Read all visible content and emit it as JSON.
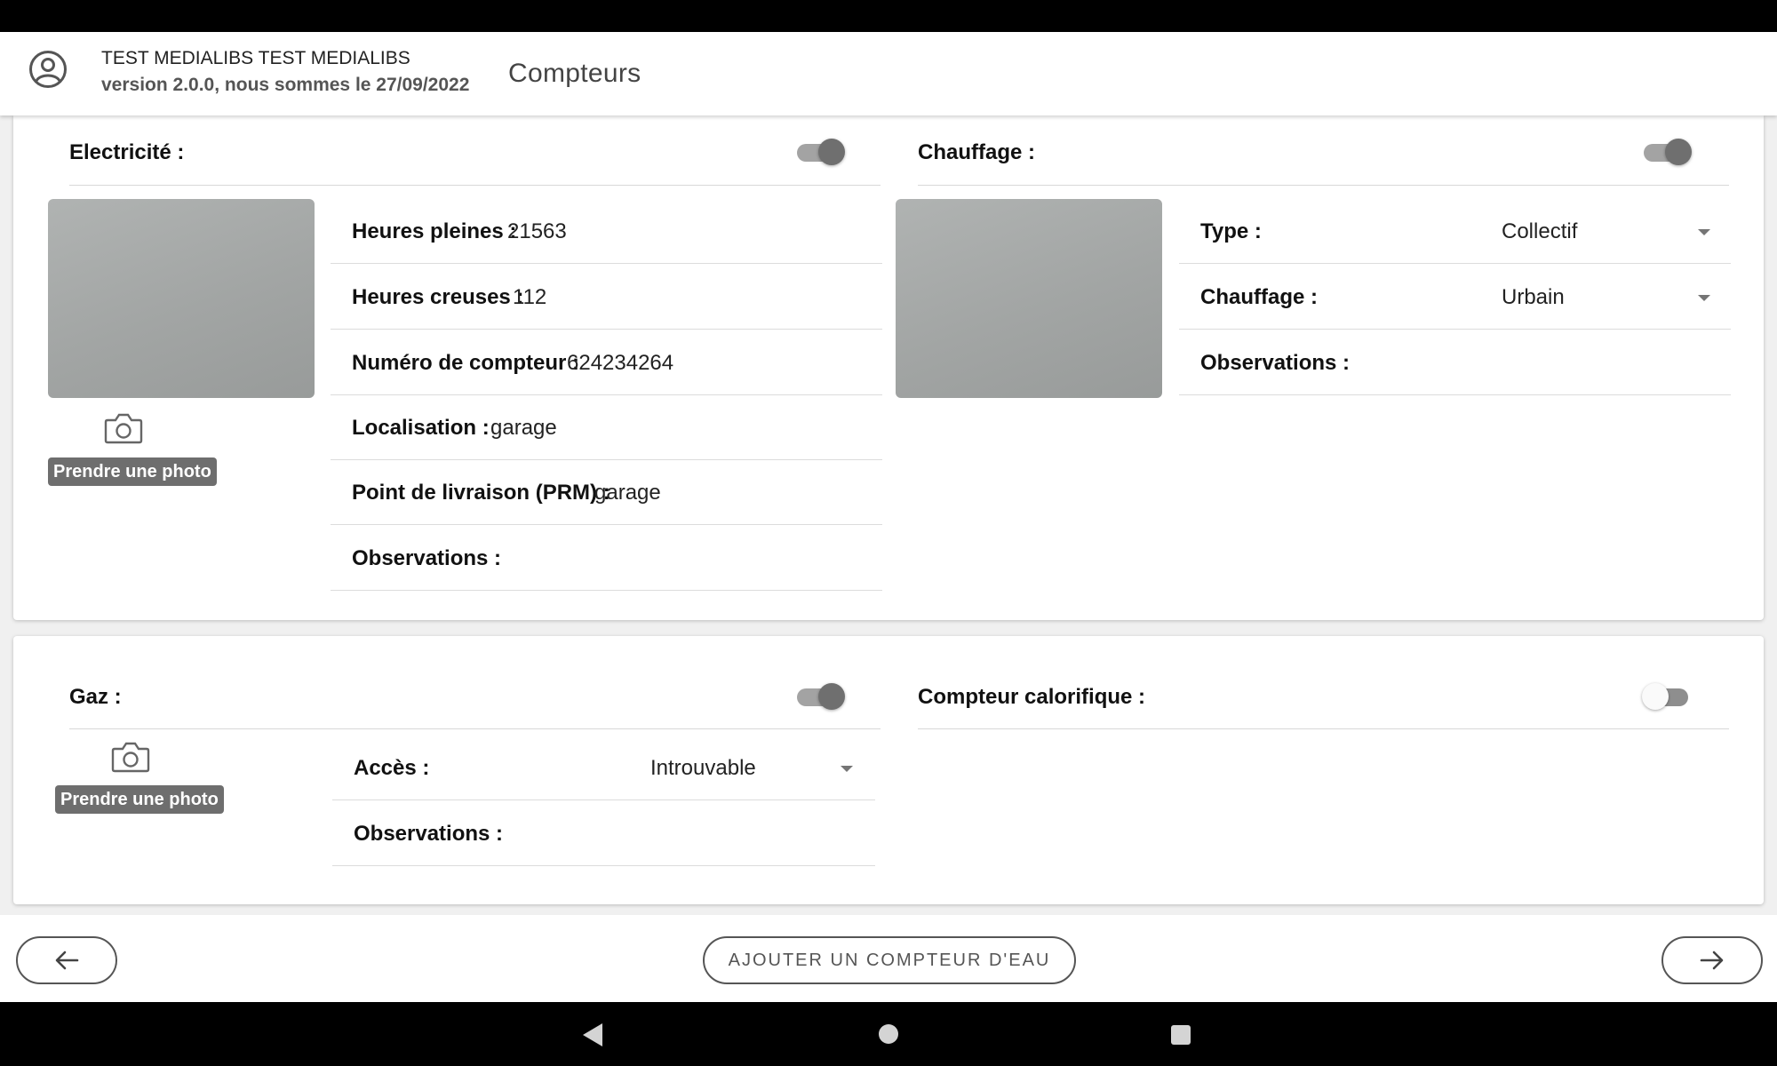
{
  "header": {
    "user_name": "TEST MEDIALIBS TEST MEDIALIBS",
    "version_line": "version 2.0.0, nous sommes le 27/09/2022",
    "title": "Compteurs"
  },
  "electricite": {
    "title": "Electricité :",
    "enabled": true,
    "photo_button": "Prendre une photo",
    "fields": [
      {
        "label": "Heures pleines :",
        "value": "21563"
      },
      {
        "label": "Heures creuses :",
        "value": "112"
      },
      {
        "label": "Numéro de compteur :",
        "value": "624234264"
      },
      {
        "label": "Localisation :",
        "value": "garage"
      },
      {
        "label": "Point de livraison (PRM) :",
        "value": "garage"
      },
      {
        "label": "Observations :",
        "value": ""
      }
    ]
  },
  "chauffage": {
    "title": "Chauffage :",
    "enabled": true,
    "type_label": "Type :",
    "type_value": "Collectif",
    "chauffage_label": "Chauffage :",
    "chauffage_value": "Urbain",
    "observations_label": "Observations :"
  },
  "gaz": {
    "title": "Gaz :",
    "enabled": true,
    "photo_button": "Prendre une photo",
    "acces_label": "Accès :",
    "acces_value": "Introuvable",
    "observations_label": "Observations :"
  },
  "compteur_calorifique": {
    "title": "Compteur calorifique :",
    "enabled": false
  },
  "footer": {
    "add_water_meter": "AJOUTER UN COMPTEUR D'EAU"
  },
  "icons": {
    "avatar": "account-circle-icon",
    "camera": "camera-icon",
    "back": "arrow-left-icon",
    "next": "arrow-right-icon",
    "dropdown": "chevron-down-icon"
  },
  "colors": {
    "toggle_on": "#6f6f6f",
    "toggle_track": "#a3a3a3",
    "photo_button": "#6e6e6e",
    "nav_bar": "#000000"
  }
}
